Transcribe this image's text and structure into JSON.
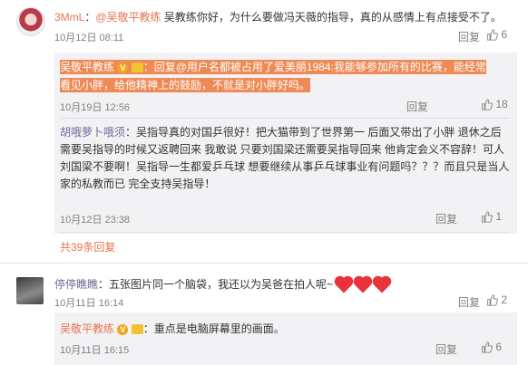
{
  "c1": {
    "user": "3MmL",
    "sep": "：",
    "mention": "@吴敬平教练",
    "text": " 吴教练你好，为什么要做冯天薇的指导，真的从感情上有点接受不了。",
    "time": "10月12日 08:11",
    "reply": "回复",
    "likes": "6"
  },
  "r1": {
    "user": "吴敬平教练",
    "text": "：回复@用户名都被占用了爱美丽1984:我能够参加所有的比赛，能经常看见小胖，给他精神上的鼓励，不就是对小胖好吗。",
    "time": "10月19日 12:56",
    "likes": "18"
  },
  "r2": {
    "user": "胡哦萝卜哦须",
    "text": "：吴指导真的对国乒很好！把大猫带到了世界第一 后面又带出了小胖 退休之后需要吴指导的时候又返聘回来 我敢说 只要刘国梁还需要吴指导回来 他肯定会义不容辞！可人刘国梁不要啊！吴指导一生都爱乒乓球 想要继续从事乒乓球事业有问题吗？？？而且只是当人家的私教而已 完全支持吴指导！",
    "time": "10月12日 23:38",
    "likes": "1"
  },
  "more_replies": "共39条回复",
  "c2": {
    "user": "停停瞧瞧",
    "text": "：五张图片同一个脑袋，我还以为吴爸在拍人呢~",
    "time": "10月11日 16:14",
    "reply": "回复",
    "likes": "2"
  },
  "r3": {
    "user": "吴敬平教练",
    "text": "：重点是电脑屏幕里的画面。",
    "time": "10月11日 16:15",
    "reply": "回复",
    "likes": "6"
  },
  "common": {
    "reply_label": "回复",
    "verified": "V"
  },
  "colors": {
    "accent": "#eb7350",
    "highlight": "#ee8a56",
    "heart": "#e8333a"
  }
}
